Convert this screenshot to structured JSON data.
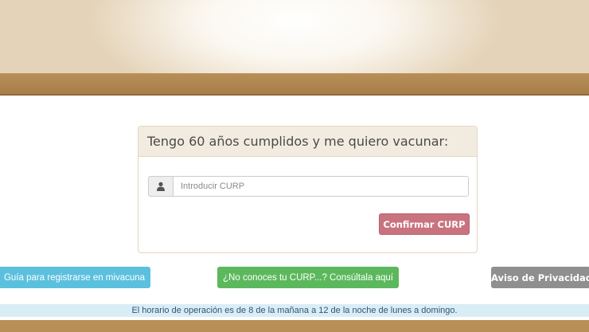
{
  "panel": {
    "title": "Tengo 60 años cumplidos y me quiero vacunar:",
    "input": {
      "placeholder": "Introducir CURP",
      "value": "",
      "icon": "user-icon"
    },
    "confirm_label": "Confirmar CURP"
  },
  "links": {
    "guide_label": "Guía para registrarse en mivacuna",
    "curp_lookup_label": "¿No conoces tu CURP...? Consúltala aquí",
    "privacy_label": "Aviso de Privacidad"
  },
  "notice": {
    "hours": "El horario de operación es de 8 de la mañana a 12 de la noche de lunes a domingo."
  },
  "colors": {
    "brand_brown": "#b88f57",
    "confirm": "#c9737f",
    "info": "#5bc0de",
    "success": "#5cb85c",
    "neutral": "#8f8f8f",
    "notice_bg": "#d9edf7"
  }
}
